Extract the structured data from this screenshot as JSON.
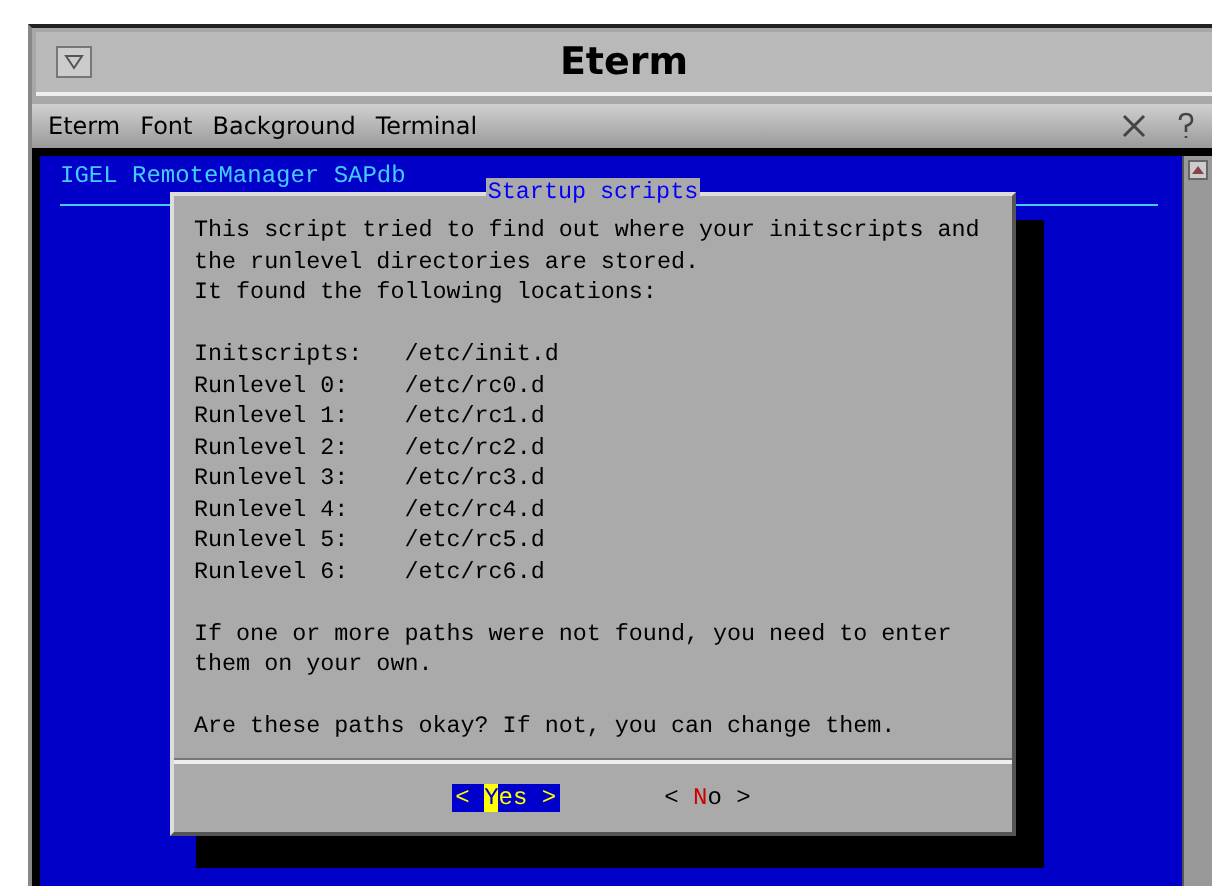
{
  "window": {
    "title": "Eterm"
  },
  "menu": [
    "Eterm",
    "Font",
    "Background",
    "Terminal"
  ],
  "terminal": {
    "header": "IGEL RemoteManager SAPdb"
  },
  "dialog": {
    "title": "Startup scripts",
    "paragraphs": [
      [
        "This script tried to find out where your initscripts and",
        "the runlevel directories are stored.",
        "It found the following locations:"
      ],
      [
        "Initscripts:   /etc/init.d",
        "Runlevel 0:    /etc/rc0.d",
        "Runlevel 1:    /etc/rc1.d",
        "Runlevel 2:    /etc/rc2.d",
        "Runlevel 3:    /etc/rc3.d",
        "Runlevel 4:    /etc/rc4.d",
        "Runlevel 5:    /etc/rc5.d",
        "Runlevel 6:    /etc/rc6.d"
      ],
      [
        "If one or more paths were not found, you need to enter",
        "them on your own."
      ],
      [
        "Are these paths okay? If not, you can change them."
      ]
    ],
    "buttons": [
      {
        "open": "<",
        "label": "Yes",
        "close": ">",
        "selected": true
      },
      {
        "open": "<",
        "label": "No",
        "close": ">",
        "selected": false
      }
    ]
  }
}
